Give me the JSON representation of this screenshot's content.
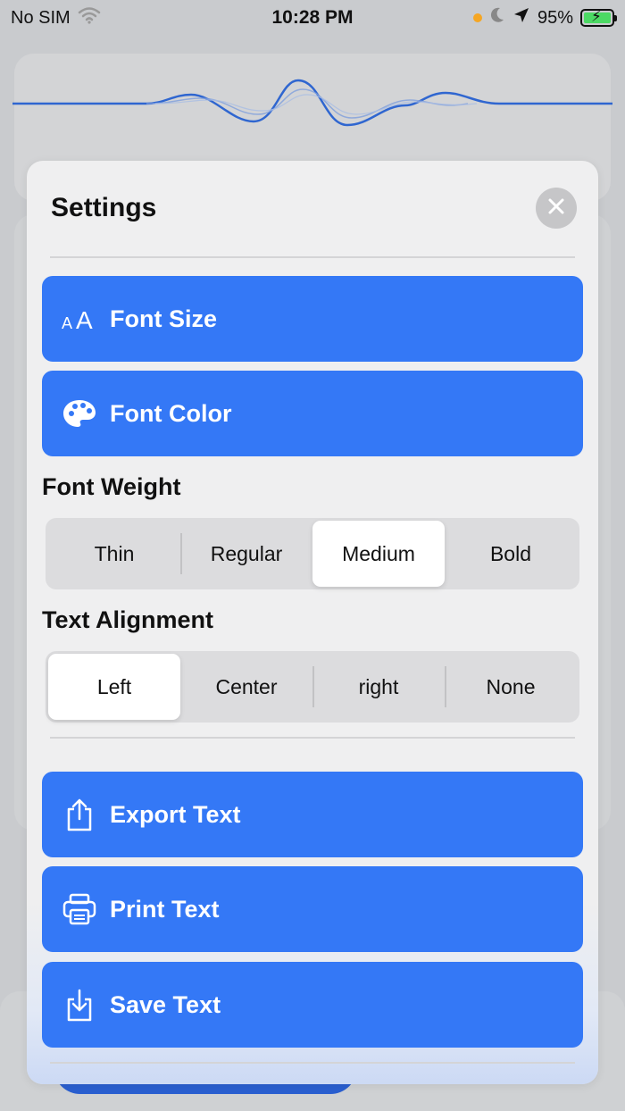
{
  "status_bar": {
    "carrier": "No SIM",
    "time": "10:28 PM",
    "battery": "95%"
  },
  "settings": {
    "title": "Settings",
    "font_size_label": "Font Size",
    "font_color_label": "Font Color",
    "font_weight": {
      "label": "Font Weight",
      "options": [
        "Thin",
        "Regular",
        "Medium",
        "Bold"
      ],
      "selected": "Medium"
    },
    "text_alignment": {
      "label": "Text Alignment",
      "options": [
        "Left",
        "Center",
        "right",
        "None"
      ],
      "selected": "Left"
    },
    "export_label": "Export Text",
    "print_label": "Print Text",
    "save_label": "Save Text"
  },
  "colors": {
    "accent": "#3478f6",
    "sheet_background": "#efeff0",
    "segment_background": "#dcdcde"
  },
  "icons": {
    "font_size": "font-size-icon",
    "font_color": "palette-icon",
    "export": "share-icon",
    "print": "printer-icon",
    "save": "download-icon",
    "close": "close-icon"
  }
}
